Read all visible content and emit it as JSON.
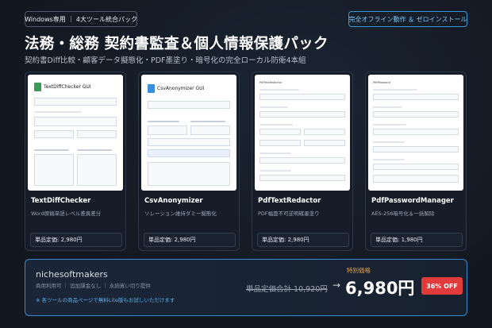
{
  "header": {
    "platform_badge": "Windows専用 ｜ 4大ツール統合パック",
    "feature_badge": "完全オフライン動作 ＆ ゼロインストール",
    "title": "法務・総務 契約書監査＆個人情報保護パック",
    "subtitle": "契約書Diff比較・顧客データ擬態化・PDF墨塗り・暗号化の完全ローカル防衛4本組"
  },
  "products": [
    {
      "name": "TextDiffChecker",
      "desc": "Word原稿単語レベル差異差分",
      "price": "単品定価: 2,980円",
      "window_title": "TextDiffChecker GUI",
      "icon_color": "#3c9a5a"
    },
    {
      "name": "CsvAnonymizer",
      "desc": "ソレーション維持ダミー擬態化",
      "price": "単品定価: 2,980円",
      "window_title": "CsvAnonymizer GUI",
      "icon_color": "#3b8fd6"
    },
    {
      "name": "PdfTextRedactor",
      "desc": "PDF幅面不可逆明確墨塗り",
      "price": "単品定価: 2,980円",
      "window_title": "PdfTextRedactor",
      "icon_color": "#888888"
    },
    {
      "name": "PdfPasswordManager",
      "desc": "AES-256暗号化＆一括解除",
      "price": "単品定価: 1,980円",
      "window_title": "PdfPassword",
      "icon_color": "#888888"
    }
  ],
  "offer": {
    "shop": "nichesoftmakers",
    "shop_sub": "商用利用可 ｜ 追加課金なし ｜ 永続買い切り提供",
    "note": "※ 各ツールの商品ページで無料Lite版もお試しいただけます",
    "special_label": "特別価格",
    "old_price": "単品定価合計 10,920円",
    "arrow": "→",
    "new_price": "6,980円",
    "discount": "36% OFF"
  },
  "colors": {
    "accent": "#3a88cc",
    "discount": "#e23b3b",
    "special": "#f1a33a"
  }
}
